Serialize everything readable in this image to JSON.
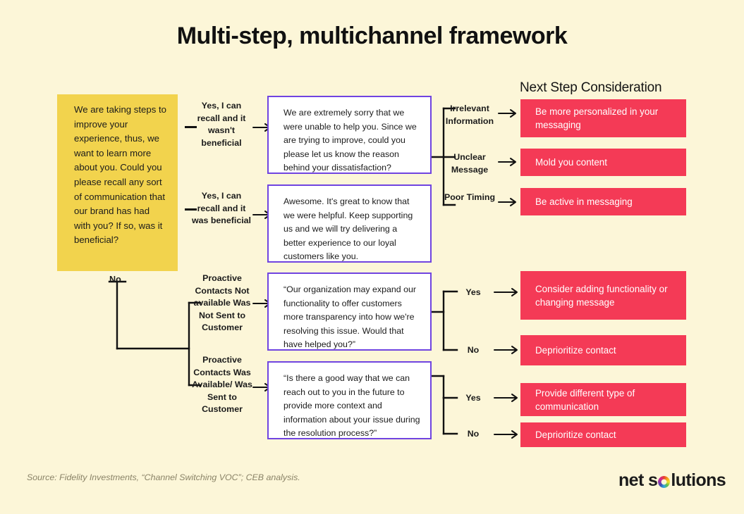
{
  "page": {
    "title": "Multi-step, multichannel framework",
    "background_color": "#FCF6D8",
    "accent_pink": "#F43A56",
    "accent_yellow": "#F2D34D",
    "accent_purple": "#7044E0"
  },
  "question": {
    "text": "We are taking steps to improve your experience, thus, we want to learn more about you. Could you please recall any sort of communication that our brand has had with you? If so, was it beneficial?",
    "no_label": "No"
  },
  "branches": [
    {
      "label": "Yes, I can recall and it wasn't beneficial"
    },
    {
      "label": "Yes, I can recall and it was beneficial"
    },
    {
      "label": "Proactive Contacts Not available Was Not Sent to Customer"
    },
    {
      "label": "Proactive Contacts Was Available/ Was Sent to Customer"
    }
  ],
  "responses": [
    {
      "text": "We are extremely sorry that we were unable to help you. Since we are trying to improve, could you please let us know the reason behind your dissatisfaction?"
    },
    {
      "text": "Awesome. It's great to know that we were helpful. Keep supporting us and we will try delivering a better experience to our loyal customers like you."
    },
    {
      "text": "“Our organization may expand our functionality to offer customers more transparency into how we're resolving this issue. Would that have helped you?”"
    },
    {
      "text": "“Is there a good way that we can reach out to you in the future to provide more context and information about your issue during the resolution process?”"
    }
  ],
  "outcomes": [
    {
      "label": "Irrelevant Information"
    },
    {
      "label": "Unclear Message"
    },
    {
      "label": "Poor Timing"
    },
    {
      "label": "Yes"
    },
    {
      "label": "No"
    },
    {
      "label": "Yes"
    },
    {
      "label": "No"
    }
  ],
  "next_step": {
    "header": "Next Step Consideration",
    "actions": [
      {
        "text": "Be more personalized in your messaging"
      },
      {
        "text": "Mold you content"
      },
      {
        "text": "Be active in messaging"
      },
      {
        "text": "Consider adding functionality or changing message"
      },
      {
        "text": "Deprioritize contact"
      },
      {
        "text": "Provide different type of communication"
      },
      {
        "text": "Deprioritize contact"
      }
    ]
  },
  "footer": {
    "source": "Source: Fidelity Investments, “Channel Switching VOC”; CEB analysis.",
    "logo_first": "net s",
    "logo_ring_icon": "multicolor-ring-icon",
    "logo_last": "lutions"
  }
}
